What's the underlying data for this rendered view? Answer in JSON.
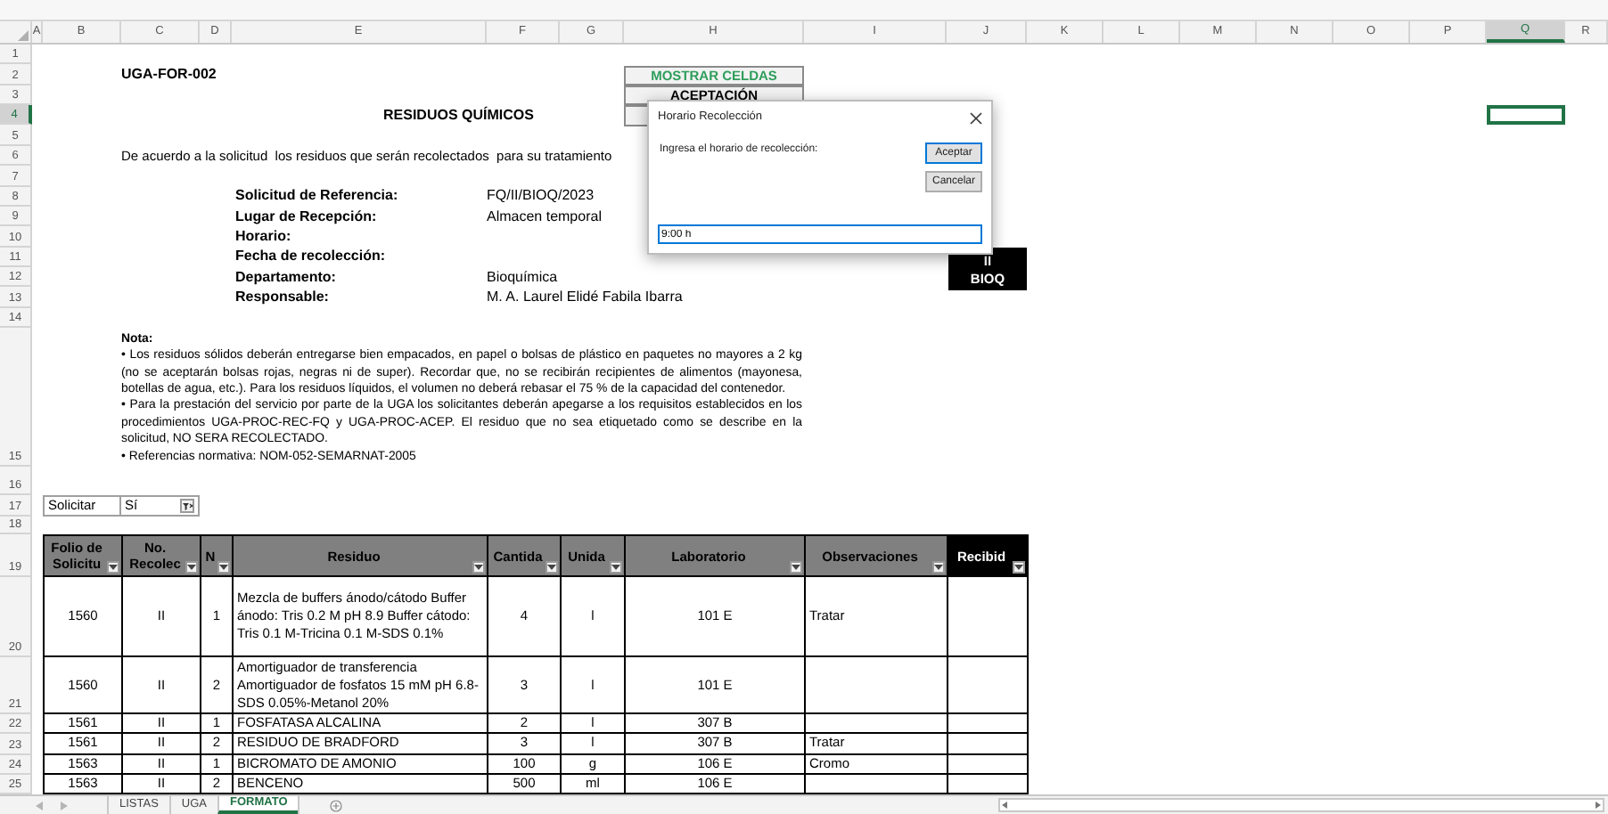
{
  "column_headers": [
    {
      "label": "A",
      "selected": false
    },
    {
      "label": "B",
      "selected": false
    },
    {
      "label": "C",
      "selected": false
    },
    {
      "label": "D",
      "selected": false
    },
    {
      "label": "E",
      "selected": false
    },
    {
      "label": "F",
      "selected": false
    },
    {
      "label": "G",
      "selected": false
    },
    {
      "label": "H",
      "selected": false
    },
    {
      "label": "I",
      "selected": false
    },
    {
      "label": "J",
      "selected": false
    },
    {
      "label": "K",
      "selected": false
    },
    {
      "label": "L",
      "selected": false
    },
    {
      "label": "M",
      "selected": false
    },
    {
      "label": "N",
      "selected": false
    },
    {
      "label": "O",
      "selected": false
    },
    {
      "label": "P",
      "selected": false
    },
    {
      "label": "Q",
      "selected": true
    },
    {
      "label": "R",
      "selected": false
    }
  ],
  "row_headers": [
    {
      "label": "1",
      "selected": false
    },
    {
      "label": "2",
      "selected": false
    },
    {
      "label": "3",
      "selected": false
    },
    {
      "label": "4",
      "selected": true
    },
    {
      "label": "5",
      "selected": false
    },
    {
      "label": "6",
      "selected": false
    },
    {
      "label": "7",
      "selected": false
    },
    {
      "label": "8",
      "selected": false
    },
    {
      "label": "9",
      "selected": false
    },
    {
      "label": "10",
      "selected": false
    },
    {
      "label": "11",
      "selected": false
    },
    {
      "label": "12",
      "selected": false
    },
    {
      "label": "13",
      "selected": false
    },
    {
      "label": "14",
      "selected": false
    },
    {
      "label": "15",
      "selected": false
    },
    {
      "label": "16",
      "selected": false
    },
    {
      "label": "17",
      "selected": false
    },
    {
      "label": "18",
      "selected": false
    },
    {
      "label": "19",
      "selected": false
    },
    {
      "label": "20",
      "selected": false
    },
    {
      "label": "21",
      "selected": false
    },
    {
      "label": "22",
      "selected": false
    },
    {
      "label": "23",
      "selected": false
    },
    {
      "label": "24",
      "selected": false
    },
    {
      "label": "25",
      "selected": false
    }
  ],
  "form": {
    "code": "UGA-FOR-002",
    "title": "RESIDUOS QUÍMICOS",
    "intro": "De acuerdo a la solicitud  los residuos que serán recolectados  para su tratamiento",
    "fields": [
      {
        "label": "Solicitud de Referencia:",
        "value": "FQ/II/BIOQ/2023"
      },
      {
        "label": "Lugar de Recepción:",
        "value": "Almacen temporal"
      },
      {
        "label": "Horario:"
      },
      {
        "label": "Fecha de recolección:"
      },
      {
        "label": "Departamento:",
        "value": "Bioquímica"
      },
      {
        "label": "Responsable:",
        "value": "M. A. Laurel Elidé Fabila Ibarra"
      }
    ],
    "note": {
      "heading": "Nota:",
      "paragraphs": [
        "• Los residuos sólidos deberán entregarse bien empacados, en papel o bolsas de plástico en paquetes no mayores a 2 kg (no se aceptarán bolsas rojas, negras ni de super). Recordar que, no se recibirán recipientes de alimentos (mayonesa, botellas de agua, etc.). Para los residuos líquidos, el volumen no deberá rebasar el 75 % de la capacidad del contenedor.",
        "• Para la prestación del servicio por parte de la UGA los solicitantes deberán apegarse a los requisitos establecidos en los procedimientos UGA-PROC-REC-FQ y UGA-PROC-ACEP. El residuo que no sea etiquetado como se describe en la solicitud, NO SERA RECOLECTADO.",
        "• Referencias normativa: NOM-052-SEMARNAT-2005"
      ]
    }
  },
  "sheet_buttons": [
    {
      "label": "MOSTRAR CELDAS",
      "color": "#2e9e5b"
    },
    {
      "label": "ACEPTACIÓN",
      "color": "#000000"
    }
  ],
  "badge": {
    "lines": [
      "II",
      "BIOQ"
    ]
  },
  "filter": {
    "label": "Solicitar",
    "value": "Sí"
  },
  "table": {
    "columns": [
      {
        "label": "Folio de Solicitu",
        "kind": "plain"
      },
      {
        "label": "No. Recolec",
        "kind": "plain"
      },
      {
        "label": "N",
        "kind": "plain"
      },
      {
        "label": "Residuo",
        "kind": "plain"
      },
      {
        "label": "Cantida",
        "kind": "plain"
      },
      {
        "label": "Unida",
        "kind": "plain"
      },
      {
        "label": "Laboratorio",
        "kind": "plain"
      },
      {
        "label": "Observaciones",
        "kind": "plain"
      },
      {
        "label": "Recibid",
        "kind": "dark"
      }
    ],
    "rows": [
      {
        "folio": "1560",
        "recoleccion": "II",
        "n": "1",
        "residuo": "Mezcla de buffers ánodo/cátodo Buffer ánodo: Tris 0.2 M pH 8.9 Buffer cátodo: Tris 0.1 M-Tricina 0.1 M-SDS 0.1%",
        "cantidad": "4",
        "unidad": "l",
        "laboratorio": "101 E",
        "observaciones": "Tratar"
      },
      {
        "folio": "1560",
        "recoleccion": "II",
        "n": "2",
        "residuo": "Amortiguador de transferencia Amortiguador de fosfatos 15 mM pH 6.8-SDS 0.05%-Metanol 20%",
        "cantidad": "3",
        "unidad": "l",
        "laboratorio": "101 E"
      },
      {
        "folio": "1561",
        "recoleccion": "II",
        "n": "1",
        "residuo": "FOSFATASA ALCALINA",
        "cantidad": "2",
        "unidad": "l",
        "laboratorio": "307 B"
      },
      {
        "folio": "1561",
        "recoleccion": "II",
        "n": "2",
        "residuo": "RESIDUO DE BRADFORD",
        "cantidad": "3",
        "unidad": "l",
        "laboratorio": "307 B",
        "observaciones": "Tratar"
      },
      {
        "folio": "1563",
        "recoleccion": "II",
        "n": "1",
        "residuo": "BICROMATO DE AMONIO",
        "cantidad": "100",
        "unidad": "g",
        "laboratorio": "106 E",
        "observaciones": "Cromo"
      },
      {
        "folio": "1563",
        "recoleccion": "II",
        "n": "2",
        "residuo": "BENCENO",
        "cantidad": "500",
        "unidad": "ml",
        "laboratorio": "106 E"
      }
    ]
  },
  "dialog": {
    "title": "Horario Recolección",
    "prompt": "Ingresa el horario de recolección:",
    "value": "9:00 h",
    "buttons": [
      {
        "label": "Aceptar",
        "default": true
      },
      {
        "label": "Cancelar",
        "default": false
      }
    ]
  },
  "sheet_tabs": [
    {
      "label": "LISTAS",
      "selected": false
    },
    {
      "label": "UGA",
      "selected": false
    },
    {
      "label": "FORMATO",
      "selected": true
    }
  ]
}
